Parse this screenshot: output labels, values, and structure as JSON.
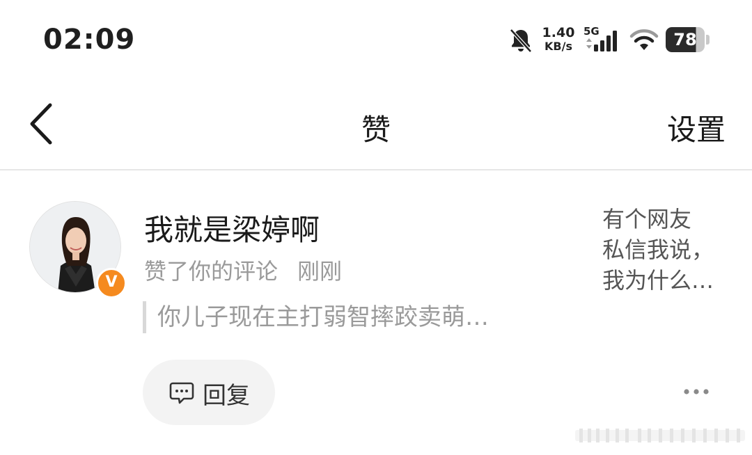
{
  "status_bar": {
    "time": "02:09",
    "speed_value": "1.40",
    "speed_unit": "KB/s",
    "network": "5G",
    "battery": "78",
    "icons": [
      "bell-off-icon",
      "signal-icon",
      "wifi-icon",
      "battery-icon"
    ]
  },
  "header": {
    "title": "赞",
    "settings_label": "设置",
    "back_icon": "chevron-left-icon"
  },
  "notification": {
    "username": "我就是梁婷啊",
    "action": "赞了你的评论",
    "time": "刚刚",
    "comment_excerpt": "你儿子现在主打弱智摔跤卖萌…",
    "post_preview": [
      "有个网友",
      "私信我说，",
      "我为什么…"
    ],
    "verified_badge": "V",
    "reply_label": "回复",
    "more_icon": "more-dots-icon"
  },
  "colors": {
    "badge": "#f58a1f",
    "muted_text": "#9a9a9a",
    "reply_bg": "#f3f3f3"
  }
}
